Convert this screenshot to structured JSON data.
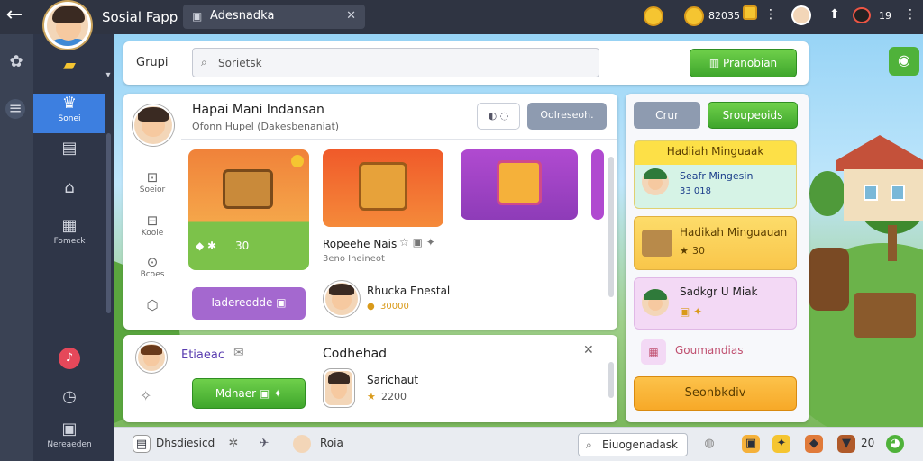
{
  "topbar": {
    "app_title": "Sosial Fapp",
    "search_tab": "Adesnadka",
    "currency_amount": "82035",
    "level_value": "19"
  },
  "sidebar": {
    "items": [
      {
        "label": "Sonei",
        "icon": "crown-icon"
      },
      {
        "label": "",
        "icon": "book-icon"
      },
      {
        "label": "",
        "icon": "home-icon"
      },
      {
        "label": "Fomeck",
        "icon": "shop-icon"
      }
    ],
    "bottom_label": "Nereaeden"
  },
  "header": {
    "group_label": "Grupi",
    "search_placeholder": "Sorietsk",
    "action_button": "Pranobian"
  },
  "main": {
    "title": "Hapai Mani Indansan",
    "subtitle": "Ofonn Hupel (Dakesbenaniat)",
    "filter_button": "Oolreseoh.",
    "side_icons": [
      "Soeior",
      "Kooie",
      "Bcoes"
    ],
    "reward_value": "30",
    "item_title": "Ropeehe Nais",
    "item_subtitle": "3eno Ineineot",
    "primary_button": "Iadereodde",
    "player_name": "Rhucka Enestal",
    "player_score": "30000"
  },
  "lower": {
    "user_name": "Etiaeac",
    "section_title": "Codhehad",
    "action_button": "Mdnaer",
    "player_name": "Sarichaut",
    "player_score": "2200"
  },
  "right": {
    "tab_1": "Crur",
    "tab_2": "Sroupeoids",
    "widget_1_title": "Hadiiah Minguaak",
    "widget_1_name": "Seafr Mingesin",
    "widget_1_value": "33 018",
    "widget_2_title": "Hadikah Minguauan",
    "widget_2_value": "30",
    "widget_3_title": "Sadkgr U Miak",
    "link_label": "Goumandias",
    "cta_button": "Seonbkdiv"
  },
  "bottombar": {
    "item_1": "Dhsdiesicd",
    "item_2": "Roia",
    "item_3": "Eiuogenadask",
    "count": "20"
  },
  "colors": {
    "accent_green": "#4fb23a",
    "accent_blue": "#3d7fe0",
    "accent_purple": "#a468cf",
    "accent_orange": "#f7a928"
  }
}
